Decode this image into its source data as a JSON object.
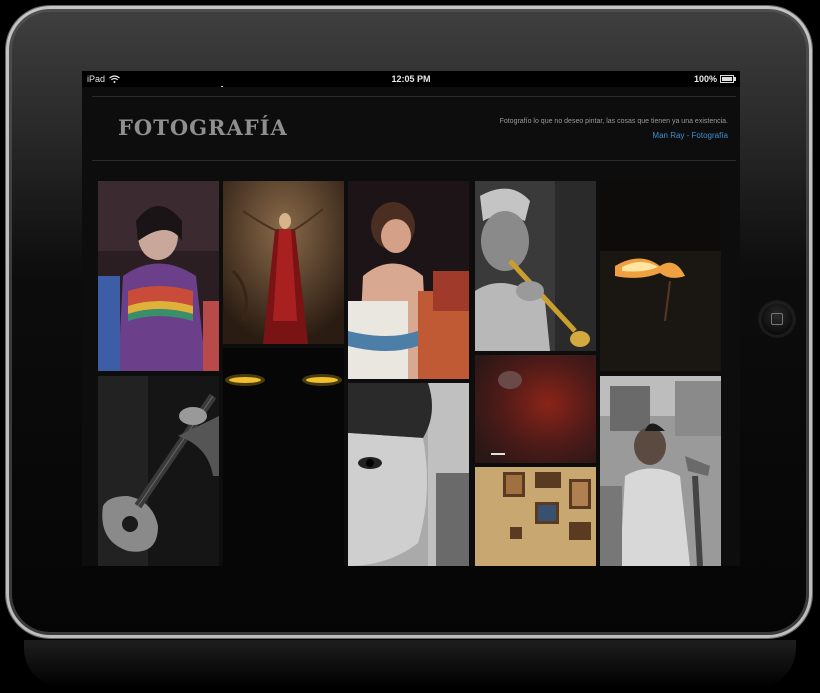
{
  "device": {
    "name": "iPad",
    "status": {
      "carrier": "iPad",
      "time": "12:05 PM",
      "battery": "100%",
      "battery_level": 1.0
    }
  },
  "site": {
    "title": "FOTOGRAFÍA",
    "quote": "Fotografío lo que no deseo pintar, las cosas que tienen ya una existencia.",
    "attribution": "Man Ray - Fotografía"
  },
  "gallery": {
    "photos": [
      {
        "id": "girl-purple-jacket",
        "icon": "photo-portrait-girl"
      },
      {
        "id": "red-cloak-figure",
        "icon": "photo-art-figure"
      },
      {
        "id": "dancer-back",
        "icon": "photo-dancer"
      },
      {
        "id": "trumpet-player",
        "icon": "photo-trumpet"
      },
      {
        "id": "fire-night",
        "icon": "photo-fire"
      },
      {
        "id": "guitar-player",
        "icon": "photo-guitar"
      },
      {
        "id": "dark-lamps",
        "icon": "photo-lamps"
      },
      {
        "id": "child-face",
        "icon": "photo-child"
      },
      {
        "id": "red-texture",
        "icon": "photo-texture"
      },
      {
        "id": "framed-wall",
        "icon": "photo-frames"
      },
      {
        "id": "man-street",
        "icon": "photo-street"
      }
    ]
  }
}
